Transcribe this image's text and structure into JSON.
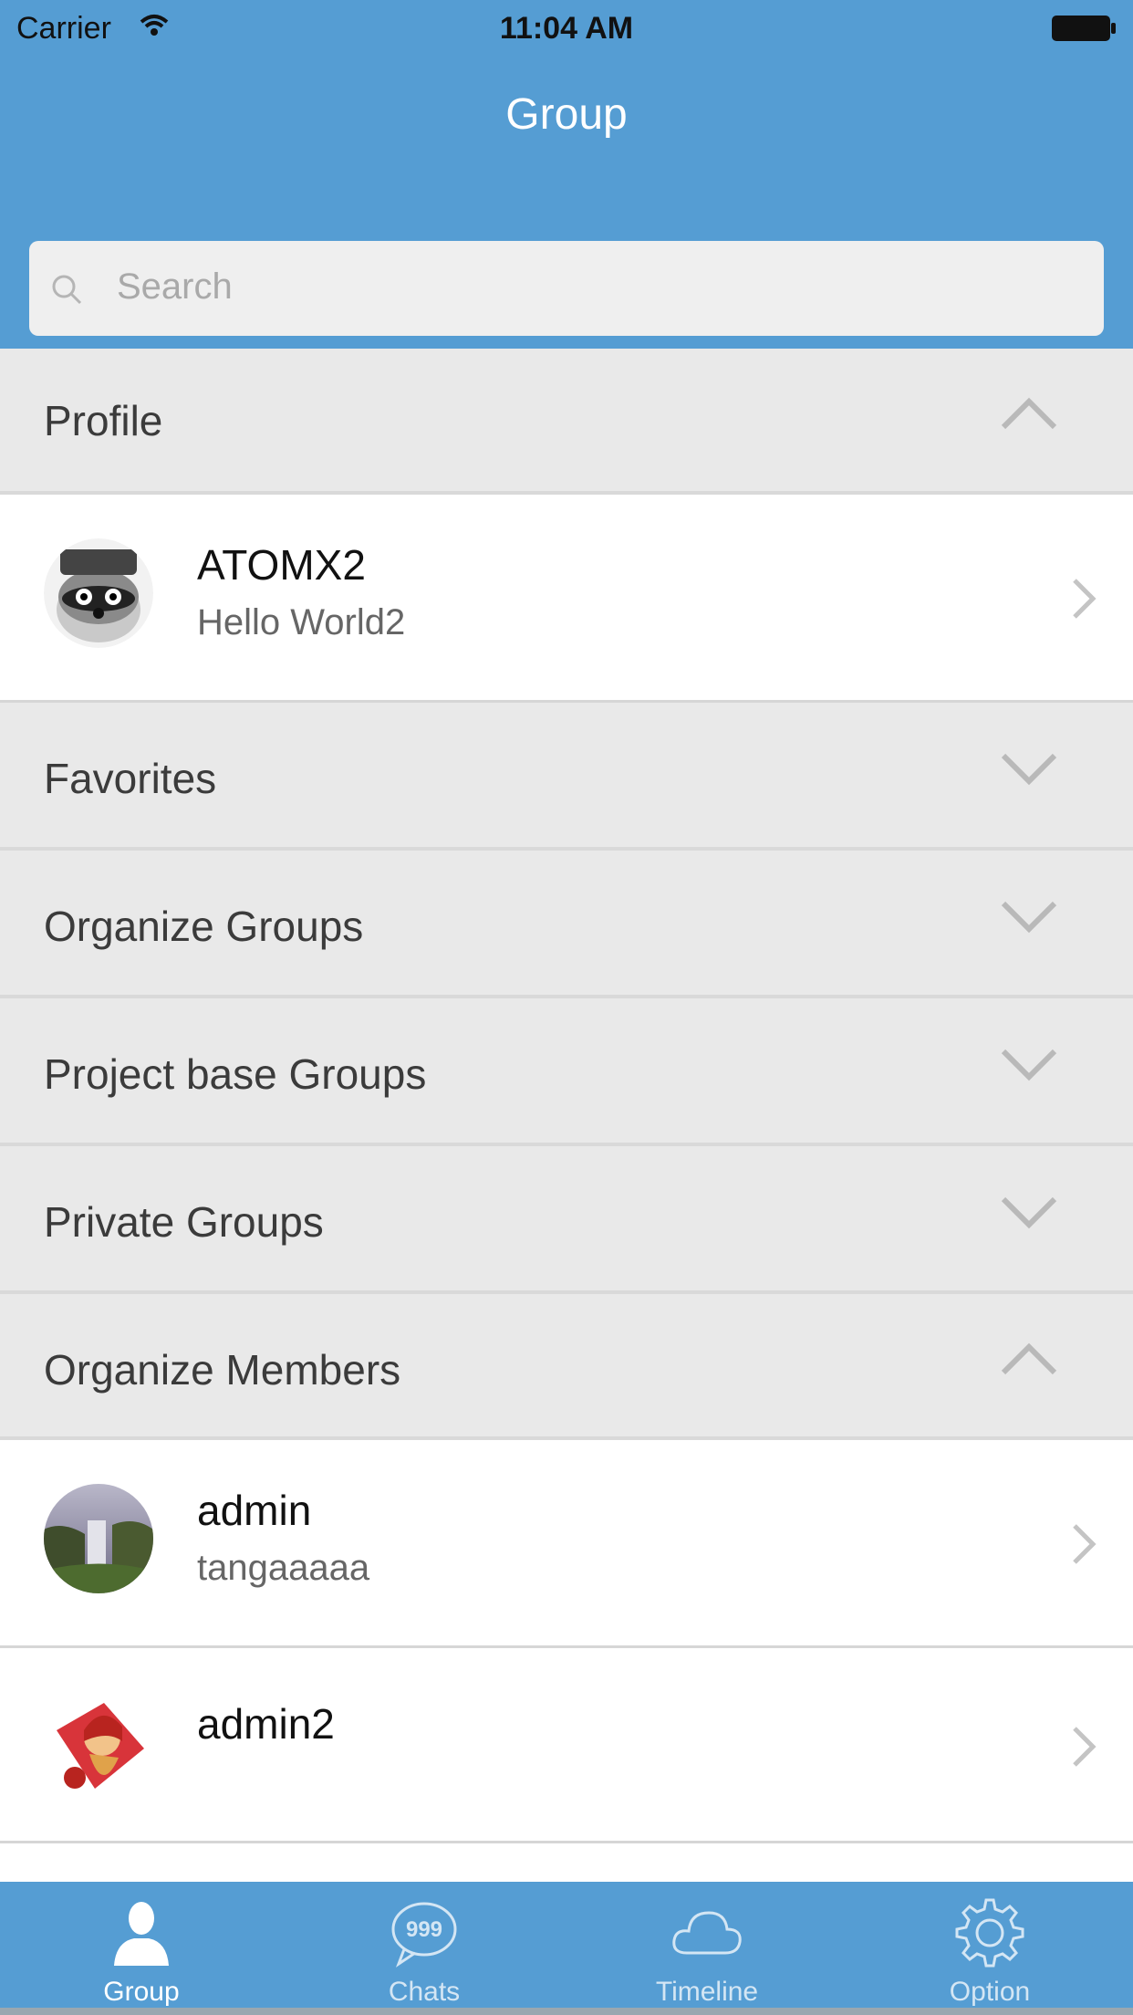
{
  "status_bar": {
    "carrier": "Carrier",
    "time": "11:04 AM",
    "battery_icon": "battery-full-icon",
    "wifi_icon": "wifi-icon"
  },
  "nav": {
    "title": "Group"
  },
  "search": {
    "placeholder": "Search",
    "icon": "search-icon"
  },
  "sections": [
    {
      "label": "Profile",
      "state": "expanded"
    },
    {
      "label": "Favorites",
      "state": "collapsed"
    },
    {
      "label": "Organize Groups",
      "state": "collapsed"
    },
    {
      "label": "Project base Groups",
      "state": "collapsed"
    },
    {
      "label": "Private Groups",
      "state": "collapsed"
    },
    {
      "label": "Organize Members",
      "state": "expanded"
    }
  ],
  "profile": {
    "name": "ATOMX2",
    "status": "Hello World2"
  },
  "members": [
    {
      "name": "admin",
      "status": "tangaaaaa"
    },
    {
      "name": "admin2",
      "status": ""
    }
  ],
  "tabs": [
    {
      "label": "Group",
      "icon": "person-icon",
      "active": true
    },
    {
      "label": "Chats",
      "icon": "chat-bubble-icon",
      "badge": "999",
      "active": false
    },
    {
      "label": "Timeline",
      "icon": "cloud-icon",
      "active": false
    },
    {
      "label": "Option",
      "icon": "gear-icon",
      "active": false
    }
  ],
  "colors": {
    "brand": "#559dd3",
    "section_bg": "#e9e9e9",
    "chevron": "#b9b9b9"
  }
}
